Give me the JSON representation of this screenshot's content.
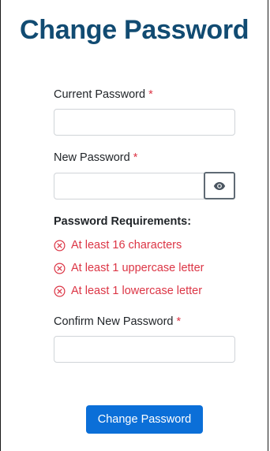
{
  "page": {
    "title": "Change Password"
  },
  "form": {
    "required_marker": "*",
    "current_password": {
      "label": "Current Password",
      "value": ""
    },
    "new_password": {
      "label": "New Password",
      "value": ""
    },
    "show_password_icon": "eye-icon",
    "requirements": {
      "heading": "Password Requirements:",
      "status_icon": "circle-x-icon",
      "items": [
        {
          "text": "At least 16 characters",
          "met": false
        },
        {
          "text": "At least 1 uppercase letter",
          "met": false
        },
        {
          "text": "At least 1 lowercase letter",
          "met": false
        }
      ]
    },
    "confirm_password": {
      "label": "Confirm New Password",
      "value": ""
    },
    "submit_label": "Change Password"
  },
  "colors": {
    "title": "#114b72",
    "required": "#dc3545",
    "error": "#dc3545",
    "primary_button": "#0b6fd8"
  }
}
